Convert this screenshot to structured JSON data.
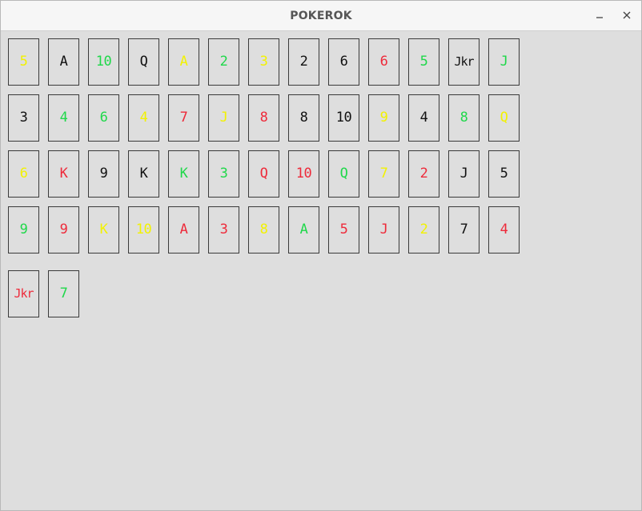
{
  "window": {
    "title": "POKEROK"
  },
  "colors": {
    "yellow": "#f2f200",
    "green": "#1fd84a",
    "red": "#ee2a3a",
    "black": "#111111"
  },
  "rows": [
    [
      {
        "label": "5",
        "color": "yellow"
      },
      {
        "label": "A",
        "color": "black"
      },
      {
        "label": "10",
        "color": "green"
      },
      {
        "label": "Q",
        "color": "black"
      },
      {
        "label": "A",
        "color": "yellow"
      },
      {
        "label": "2",
        "color": "green"
      },
      {
        "label": "3",
        "color": "yellow"
      },
      {
        "label": "2",
        "color": "black"
      },
      {
        "label": "6",
        "color": "black"
      },
      {
        "label": "6",
        "color": "red"
      },
      {
        "label": "5",
        "color": "green"
      },
      {
        "label": "Jkr",
        "color": "black"
      },
      {
        "label": "J",
        "color": "green"
      }
    ],
    [
      {
        "label": "3",
        "color": "black"
      },
      {
        "label": "4",
        "color": "green"
      },
      {
        "label": "6",
        "color": "green"
      },
      {
        "label": "4",
        "color": "yellow"
      },
      {
        "label": "7",
        "color": "red"
      },
      {
        "label": "J",
        "color": "yellow"
      },
      {
        "label": "8",
        "color": "red"
      },
      {
        "label": "8",
        "color": "black"
      },
      {
        "label": "10",
        "color": "black"
      },
      {
        "label": "9",
        "color": "yellow"
      },
      {
        "label": "4",
        "color": "black"
      },
      {
        "label": "8",
        "color": "green"
      },
      {
        "label": "Q",
        "color": "yellow"
      }
    ],
    [
      {
        "label": "6",
        "color": "yellow"
      },
      {
        "label": "K",
        "color": "red"
      },
      {
        "label": "9",
        "color": "black"
      },
      {
        "label": "K",
        "color": "black"
      },
      {
        "label": "K",
        "color": "green"
      },
      {
        "label": "3",
        "color": "green"
      },
      {
        "label": "Q",
        "color": "red"
      },
      {
        "label": "10",
        "color": "red"
      },
      {
        "label": "Q",
        "color": "green"
      },
      {
        "label": "7",
        "color": "yellow"
      },
      {
        "label": "2",
        "color": "red"
      },
      {
        "label": "J",
        "color": "black"
      },
      {
        "label": "5",
        "color": "black"
      }
    ],
    [
      {
        "label": "9",
        "color": "green"
      },
      {
        "label": "9",
        "color": "red"
      },
      {
        "label": "K",
        "color": "yellow"
      },
      {
        "label": "10",
        "color": "yellow"
      },
      {
        "label": "A",
        "color": "red"
      },
      {
        "label": "3",
        "color": "red"
      },
      {
        "label": "8",
        "color": "yellow"
      },
      {
        "label": "A",
        "color": "green"
      },
      {
        "label": "5",
        "color": "red"
      },
      {
        "label": "J",
        "color": "red"
      },
      {
        "label": "2",
        "color": "yellow"
      },
      {
        "label": "7",
        "color": "black"
      },
      {
        "label": "4",
        "color": "red"
      }
    ]
  ],
  "hand": [
    {
      "label": "Jkr",
      "color": "red"
    },
    {
      "label": "7",
      "color": "green"
    }
  ]
}
